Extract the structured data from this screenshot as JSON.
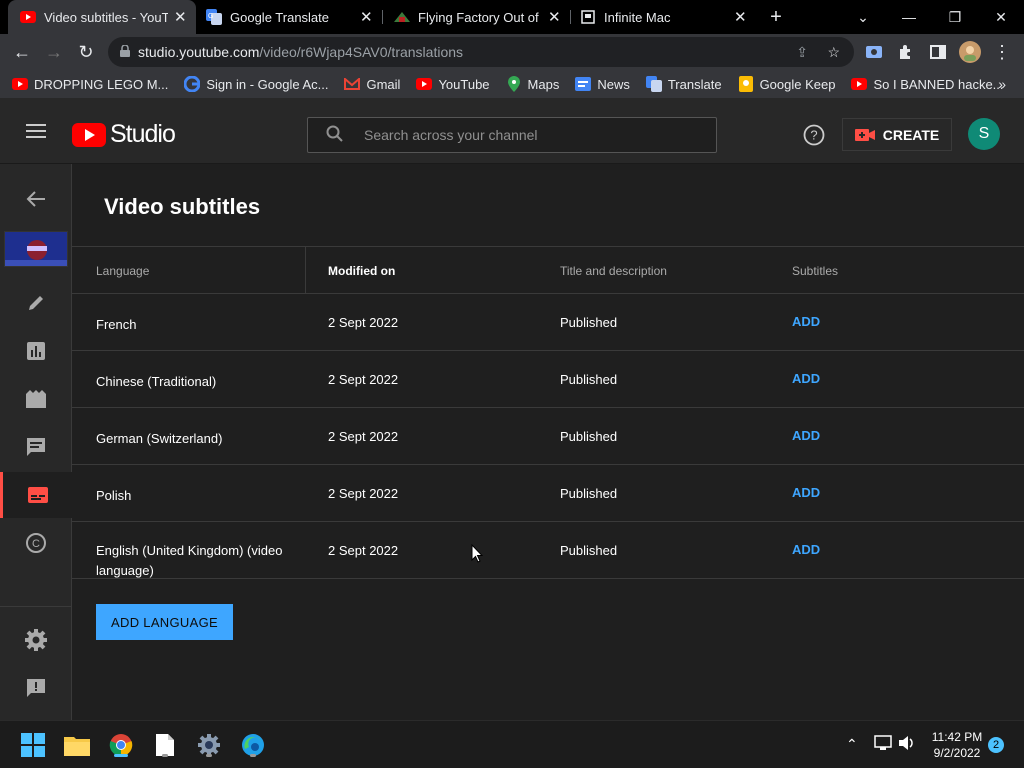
{
  "browser": {
    "tabs": [
      {
        "title": "Video subtitles - YouTu",
        "active": true
      },
      {
        "title": "Google Translate",
        "active": false
      },
      {
        "title": "Flying Factory Out of C",
        "active": false
      },
      {
        "title": "Infinite Mac",
        "active": false
      }
    ],
    "url_host": "studio.youtube.com",
    "url_path": "/video/r6Wjap4SAV0/translations",
    "bookmarks": [
      "DROPPING LEGO M...",
      "Sign in - Google Ac...",
      "Gmail",
      "YouTube",
      "Maps",
      "News",
      "Translate",
      "Google Keep",
      "So I BANNED hacke..."
    ]
  },
  "studio": {
    "logo_text": "Studio",
    "search_placeholder": "Search across your channel",
    "create_label": "CREATE",
    "avatar_letter": "S",
    "page_title": "Video subtitles",
    "columns": [
      "Language",
      "Modified on",
      "Title and description",
      "Subtitles"
    ],
    "rows": [
      {
        "language": "French",
        "modified": "2 Sept 2022",
        "title_desc": "Published",
        "subtitles": "ADD"
      },
      {
        "language": "Chinese (Traditional)",
        "modified": "2 Sept 2022",
        "title_desc": "Published",
        "subtitles": "ADD"
      },
      {
        "language": "German (Switzerland)",
        "modified": "2 Sept 2022",
        "title_desc": "Published",
        "subtitles": "ADD"
      },
      {
        "language": "Polish",
        "modified": "2 Sept 2022",
        "title_desc": "Published",
        "subtitles": "ADD"
      },
      {
        "language": "English (United Kingdom) (video language)",
        "modified": "2 Sept 2022",
        "title_desc": "Published",
        "subtitles": "ADD"
      }
    ],
    "add_language_label": "ADD LANGUAGE",
    "rail_icons": [
      "back-arrow-icon",
      "video-thumbnail",
      "pencil-icon",
      "analytics-icon",
      "editor-icon",
      "comments-icon",
      "subtitles-icon",
      "copyright-icon",
      "settings-icon",
      "feedback-icon"
    ]
  },
  "taskbar": {
    "time": "11:42 PM",
    "date": "9/2/2022",
    "notification_count": "2"
  },
  "colors": {
    "accent_blue": "#3ea6ff",
    "youtube_red": "#ff0000",
    "active_rail": "#ff4e45"
  }
}
